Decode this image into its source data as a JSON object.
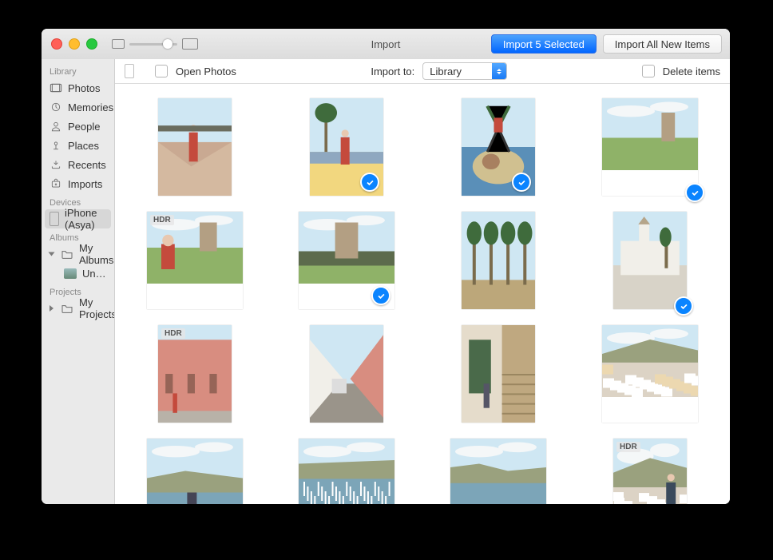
{
  "titlebar": {
    "title": "Import",
    "import_selected_label": "Import 5 Selected",
    "import_all_label": "Import All New Items"
  },
  "sidebar": {
    "sections": {
      "library": "Library",
      "devices": "Devices",
      "albums": "Albums",
      "projects": "Projects"
    },
    "library_items": [
      "Photos",
      "Memories",
      "People",
      "Places",
      "Recents",
      "Imports"
    ],
    "device": "iPhone (Asya)",
    "my_albums": "My Albums",
    "untitled_album": "Untitled Alb…",
    "my_projects": "My Projects"
  },
  "toolbar": {
    "open_photos": "Open Photos",
    "import_to": "Import to:",
    "import_to_value": "Library",
    "delete_items": "Delete items"
  },
  "photos": [
    {
      "orient": "p",
      "hdr": false,
      "selected": false,
      "scene": "person-plaza"
    },
    {
      "orient": "p",
      "hdr": false,
      "selected": true,
      "scene": "person-palm"
    },
    {
      "orient": "p",
      "hdr": false,
      "selected": true,
      "scene": "jump-map"
    },
    {
      "orient": "l",
      "hdr": false,
      "selected": true,
      "scene": "tower-field",
      "selcorner": true
    },
    {
      "orient": "l",
      "hdr": true,
      "selected": false,
      "scene": "person-field"
    },
    {
      "orient": "l",
      "hdr": false,
      "selected": true,
      "scene": "tower-trees"
    },
    {
      "orient": "p",
      "hdr": false,
      "selected": false,
      "scene": "palms"
    },
    {
      "orient": "p",
      "hdr": false,
      "selected": true,
      "scene": "white-church",
      "selcorner": true
    },
    {
      "orient": "p",
      "hdr": true,
      "selected": false,
      "scene": "pink-house"
    },
    {
      "orient": "p",
      "hdr": false,
      "selected": false,
      "scene": "street"
    },
    {
      "orient": "p",
      "hdr": false,
      "selected": false,
      "scene": "door-stairs"
    },
    {
      "orient": "l",
      "hdr": false,
      "selected": false,
      "scene": "town-view"
    },
    {
      "orient": "l",
      "hdr": false,
      "selected": false,
      "scene": "cloudy-back"
    },
    {
      "orient": "l",
      "hdr": false,
      "selected": false,
      "scene": "harbor"
    },
    {
      "orient": "l",
      "hdr": false,
      "selected": false,
      "scene": "bay"
    },
    {
      "orient": "p",
      "hdr": true,
      "selected": false,
      "scene": "person-town"
    }
  ],
  "hdr_label": "HDR"
}
